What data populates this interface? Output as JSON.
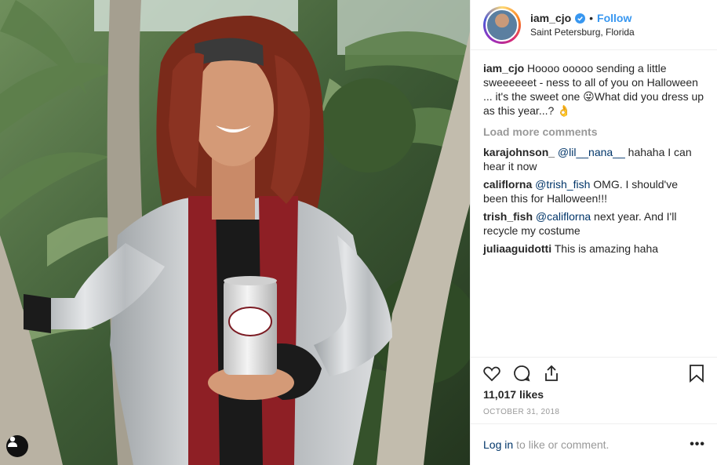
{
  "post": {
    "photo": {
      "description_icon": "person-tag-icon",
      "can_brand": "Dr Pepper",
      "can_sub": "Diet"
    },
    "header": {
      "username": "iam_cjo",
      "separator": "•",
      "follow_label": "Follow",
      "location": "Saint Petersburg, Florida",
      "verified_icon": "verified-badge-icon"
    },
    "caption": {
      "username": "iam_cjo",
      "text": "Hoooo ooooo sending a little sweeeeeet - ness to all of you on Halloween ... it's the sweet one 😜What did you dress up as this year...? 👌"
    },
    "load_more": "Load more comments",
    "comments": [
      {
        "username": "karajohnson_",
        "mention": "@lil__nana__",
        "text": " hahaha I can hear it now"
      },
      {
        "username": "califlorna",
        "mention": "@trish_fish",
        "text": " OMG. I should've been this for Halloween!!!"
      },
      {
        "username": "trish_fish",
        "mention": "@califlorna",
        "text": " next year. And I'll recycle my costume"
      },
      {
        "username": "juliaaguidotti",
        "mention": "",
        "text": "This is amazing haha"
      }
    ],
    "likes": "11,017 likes",
    "date": "OCTOBER 31, 2018",
    "login": {
      "link": "Log in",
      "rest": "to like or comment.",
      "more": "•••"
    },
    "colors": {
      "link_blue": "#3897f0",
      "mention_blue": "#003569",
      "muted": "#999999"
    }
  }
}
